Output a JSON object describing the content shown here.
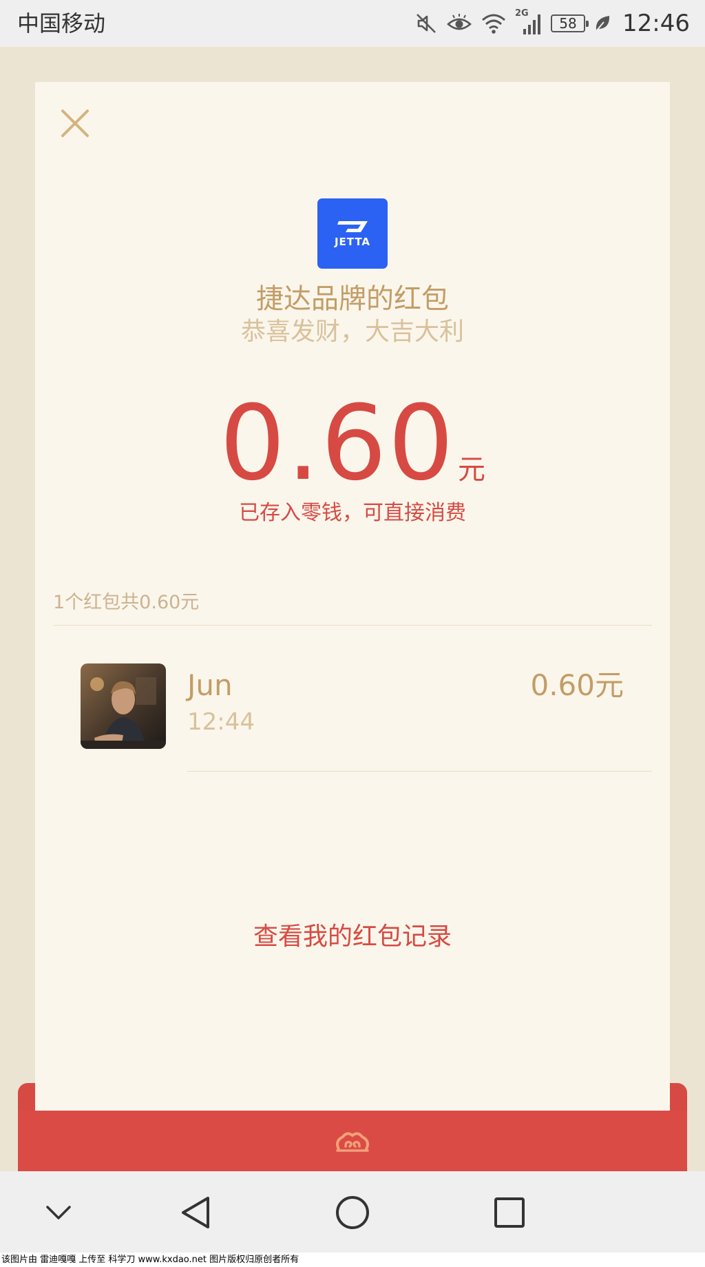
{
  "status_bar": {
    "carrier": "中国移动",
    "network": "2G",
    "battery": "58",
    "time": "12:46"
  },
  "packet": {
    "brand_logo_text": "JETTA",
    "title": "捷达品牌的红包",
    "blessing": "恭喜发财，大吉大利",
    "amount": "0.60",
    "amount_unit": "元",
    "deposited_note": "已存入零钱，可直接消费"
  },
  "summary": "1个红包共0.60元",
  "records": [
    {
      "name": "Jun",
      "time": "12:44",
      "amount": "0.60元"
    }
  ],
  "history_link": "查看我的红包记录",
  "watermark": "该图片由 雷迪嘎嘎 上传至 科学刀 www.kxdao.net 图片版权归原创者所有",
  "colors": {
    "accent_red": "#d64a43",
    "gold": "#c29d67",
    "light_gold": "#d8c19c",
    "card_bg": "#fbf6eb",
    "page_bg": "#ece4d2",
    "brand_blue": "#2c62f3"
  }
}
